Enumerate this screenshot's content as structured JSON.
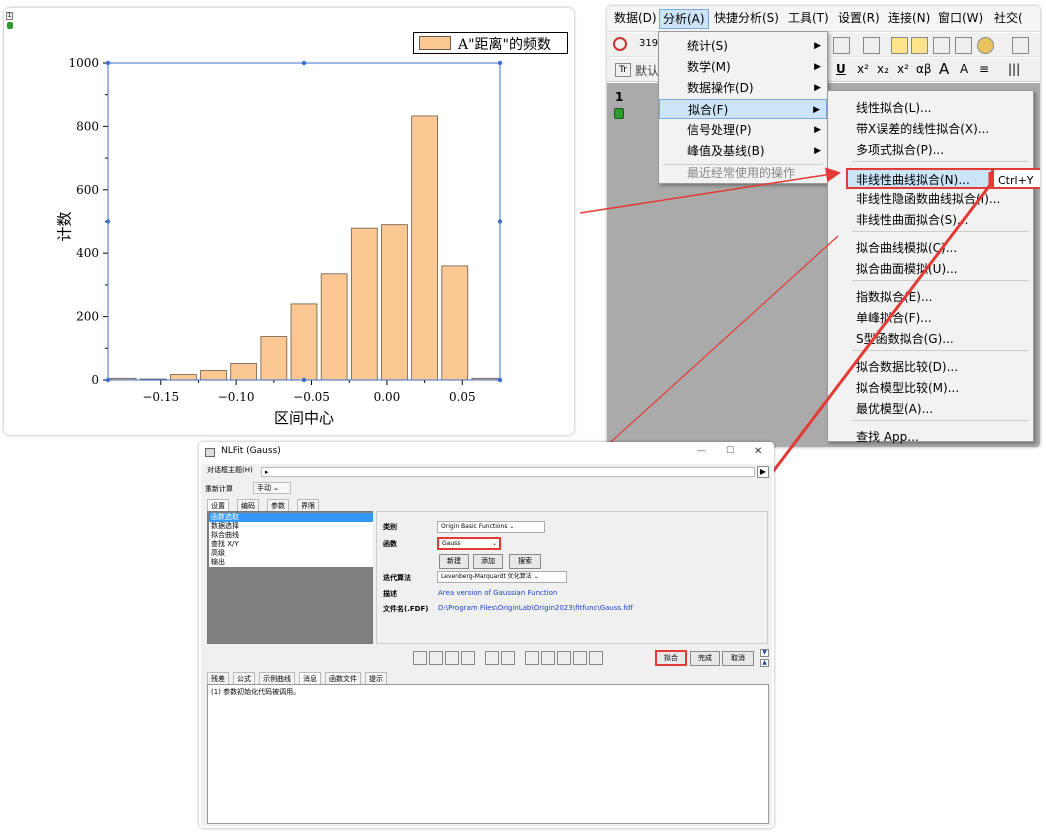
{
  "graph": {
    "layer_number": "1",
    "legend": "A\"距离\"的频数",
    "xlabel": "区间中心",
    "ylabel": "计数",
    "colors": {
      "bar_fill": "#fbc793",
      "bar_stroke": "#6d5a48",
      "selection": "#3c6fd1"
    }
  },
  "chart_data": {
    "type": "bar",
    "xlabel": "区间中心",
    "ylabel": "计数",
    "legend": [
      "A\"距离\"的频数"
    ],
    "x": [
      -0.175,
      -0.155,
      -0.135,
      -0.115,
      -0.095,
      -0.075,
      -0.055,
      -0.035,
      -0.015,
      0.005,
      0.025,
      0.045,
      0.065
    ],
    "values": [
      5,
      3,
      17,
      30,
      52,
      137,
      240,
      335,
      479,
      490,
      833,
      360,
      5
    ],
    "xlim": [
      -0.185,
      0.075
    ],
    "ylim": [
      0,
      1000
    ],
    "xticks": [
      "−0.15",
      "−0.10",
      "−0.05",
      "0.00",
      "0.05"
    ],
    "xtick_values": [
      -0.15,
      -0.1,
      -0.05,
      0.0,
      0.05
    ],
    "yticks": [
      "0",
      "200",
      "400",
      "600",
      "800",
      "1000"
    ],
    "ytick_values": [
      0,
      200,
      400,
      600,
      800,
      1000
    ]
  },
  "menubar": {
    "items": [
      "数据(D)",
      "分析(A)",
      "快捷分析(S)",
      "工具(T)",
      "设置(R)",
      "连接(N)",
      "窗口(W)",
      "社交("
    ],
    "active": "分析(A)"
  },
  "toolbar": {
    "num": "319",
    "default": "默认"
  },
  "workbook": {
    "layer_number": "1"
  },
  "analysis_menu": {
    "items": [
      {
        "label": "统计(S)",
        "arrow": "▶"
      },
      {
        "label": "数学(M)",
        "arrow": "▶"
      },
      {
        "label": "数据操作(D)",
        "arrow": "▶"
      },
      {
        "label": "拟合(F)",
        "arrow": "▶"
      },
      {
        "label": "信号处理(P)",
        "arrow": "▶"
      },
      {
        "label": "峰值及基线(B)",
        "arrow": "▶"
      }
    ],
    "recent": "最近经常使用的操作"
  },
  "fit_menu": {
    "items": [
      "线性拟合(L)...",
      "带X误差的线性拟合(X)...",
      "多项式拟合(P)...",
      "非线性曲线拟合(N)...",
      "非线性隐函数曲线拟合(I)...",
      "非线性曲面拟合(S)...",
      "拟合曲线模拟(C)...",
      "拟合曲面模拟(U)...",
      "指数拟合(E)...",
      "单峰拟合(F)...",
      "S型函数拟合(G)...",
      "拟合数据比较(D)...",
      "拟合模型比较(M)...",
      "最优模型(A)...",
      "查找 App..."
    ],
    "shortcut": "Ctrl+Y"
  },
  "dialog": {
    "title": "NLFit (Gauss)",
    "win_controls": [
      "—",
      "☐",
      "✕"
    ],
    "theme_label": "对话框主题(H)",
    "theme_value": "▸",
    "recalc_label": "重新计算",
    "recalc_value": "手动",
    "tabs": [
      "设置",
      "编码",
      "参数",
      "界限"
    ],
    "left_list": [
      "函数选取",
      "数据选择",
      "拟合曲线",
      "查找 X/Y",
      "高级",
      "输出"
    ],
    "category_label": "类别",
    "category_value": "Origin Basic Functions",
    "function_label": "函数",
    "function_value": "Gauss",
    "btn_new": "新建",
    "btn_add": "添加",
    "btn_search": "搜索",
    "algo_label": "迭代算法",
    "algo_value": "Levenberg-Marquardt 优化算法",
    "desc_label": "描述",
    "desc_value": "Area version of Gaussian Function",
    "file_label": "文件名(.FDF)",
    "file_value": "D:\\Program Files\\OriginLab\\Origin2023\\fitfunc\\Gauss.fdf",
    "btn_fit": "拟合",
    "btn_done": "完成",
    "btn_cancel": "取消",
    "bottom_tabs": [
      "残差",
      "公式",
      "示例曲线",
      "消息",
      "函数文件",
      "提示"
    ],
    "message": "(1) 参数初始化代码被调用。"
  },
  "colors": {
    "highlight_red": "#e53935",
    "menu_hover": "#cce4f7",
    "selected_list": "#3399ff",
    "link_blue": "#1a44cc"
  }
}
